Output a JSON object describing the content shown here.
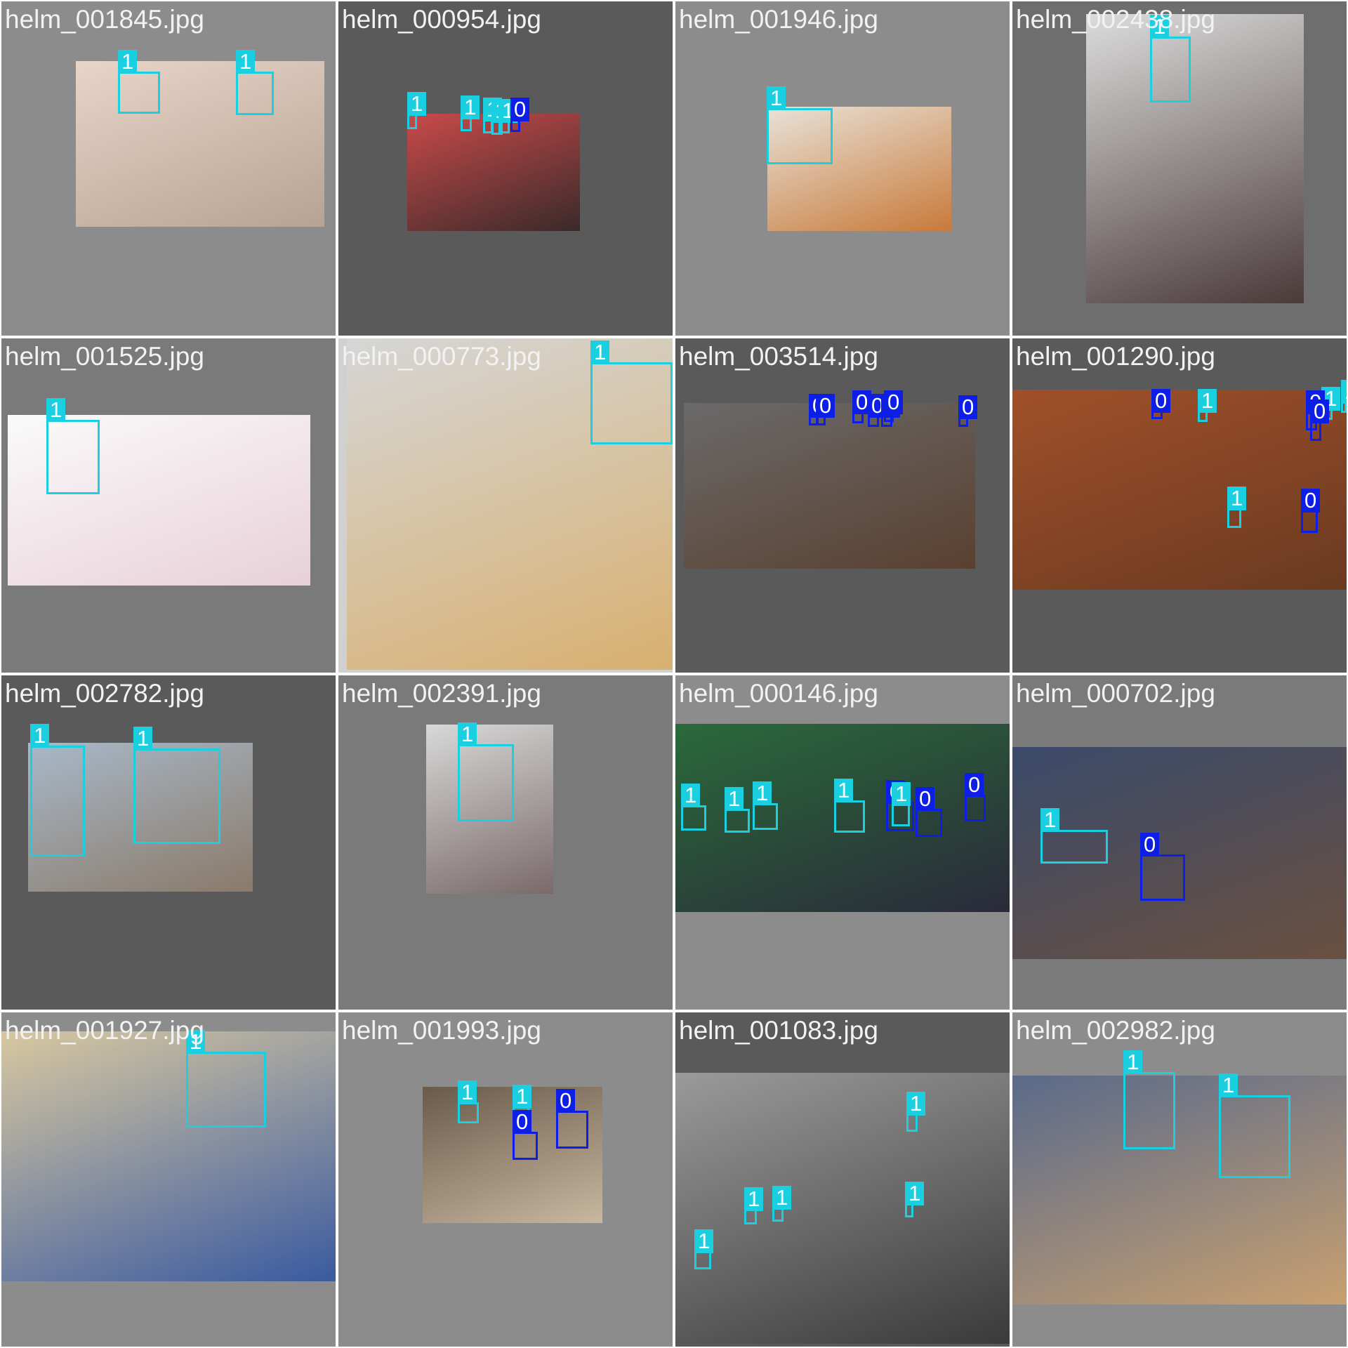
{
  "classes": {
    "0": {
      "color": "#0d1fe6"
    },
    "1": {
      "color": "#19cfe0"
    }
  },
  "tiles": [
    {
      "file": "helm_001845.jpg",
      "bg": "#8c8c8c",
      "photo_colors": [
        "#e8d5c8",
        "#b7a393"
      ],
      "boxes": [
        {
          "cls": "1"
        },
        {
          "cls": "1"
        }
      ]
    },
    {
      "file": "helm_000954.jpg",
      "bg": "#5a5a5a",
      "photo_colors": [
        "#c94a4a",
        "#3a2a2a"
      ],
      "boxes": [
        {
          "cls": "1"
        },
        {
          "cls": "1"
        },
        {
          "cls": "1"
        },
        {
          "cls": "1"
        },
        {
          "cls": "1"
        },
        {
          "cls": "0"
        }
      ]
    },
    {
      "file": "helm_001946.jpg",
      "bg": "#8c8c8c",
      "photo_colors": [
        "#e8e2d8",
        "#c87a3a"
      ],
      "boxes": [
        {
          "cls": "1"
        }
      ]
    },
    {
      "file": "helm_002438.jpg",
      "bg": "#6e6e6e",
      "photo_colors": [
        "#dcdcdc",
        "#4a3a3a"
      ],
      "boxes": [
        {
          "cls": "1"
        }
      ]
    },
    {
      "file": "helm_001525.jpg",
      "bg": "#7a7a7a",
      "photo_colors": [
        "#fafafa",
        "#e8d0d8"
      ],
      "boxes": [
        {
          "cls": "1"
        }
      ]
    },
    {
      "file": "helm_000773.jpg",
      "bg": "#d0d0d0",
      "photo_colors": [
        "#d6d6d6",
        "#d8b070"
      ],
      "boxes": [
        {
          "cls": "1"
        }
      ]
    },
    {
      "file": "helm_003514.jpg",
      "bg": "#5a5a5a",
      "photo_colors": [
        "#6a6a6a",
        "#5a4030"
      ],
      "boxes": [
        {
          "cls": "0"
        },
        {
          "cls": "0"
        },
        {
          "cls": "0"
        },
        {
          "cls": "0"
        },
        {
          "cls": "0"
        },
        {
          "cls": "0"
        },
        {
          "cls": "0"
        }
      ]
    },
    {
      "file": "helm_001290.jpg",
      "bg": "#5a5a5a",
      "photo_colors": [
        "#a0502a",
        "#6a3a20"
      ],
      "boxes": [
        {
          "cls": "0"
        },
        {
          "cls": "1"
        },
        {
          "cls": "1"
        },
        {
          "cls": "1"
        },
        {
          "cls": "0"
        },
        {
          "cls": "0"
        },
        {
          "cls": "1"
        },
        {
          "cls": "0"
        }
      ]
    },
    {
      "file": "helm_002782.jpg",
      "bg": "#5a5a5a",
      "photo_colors": [
        "#a8b8c8",
        "#8a7a6a"
      ],
      "boxes": [
        {
          "cls": "1"
        },
        {
          "cls": "1"
        }
      ]
    },
    {
      "file": "helm_002391.jpg",
      "bg": "#7a7a7a",
      "photo_colors": [
        "#d8d8d8",
        "#7a6a6a"
      ],
      "boxes": [
        {
          "cls": "1"
        }
      ]
    },
    {
      "file": "helm_000146.jpg",
      "bg": "#8c8c8c",
      "photo_colors": [
        "#2a6a3a",
        "#2a2a3a"
      ],
      "boxes": [
        {
          "cls": "1"
        },
        {
          "cls": "1"
        },
        {
          "cls": "1"
        },
        {
          "cls": "1"
        },
        {
          "cls": "0"
        },
        {
          "cls": "1"
        },
        {
          "cls": "0"
        },
        {
          "cls": "0"
        }
      ]
    },
    {
      "file": "helm_000702.jpg",
      "bg": "#7a7a7a",
      "photo_colors": [
        "#3a4a6a",
        "#6a5040"
      ],
      "boxes": [
        {
          "cls": "1"
        },
        {
          "cls": "0"
        }
      ]
    },
    {
      "file": "helm_001927.jpg",
      "bg": "#8c8c8c",
      "photo_colors": [
        "#d8c8a0",
        "#3a5aa0"
      ],
      "boxes": [
        {
          "cls": "1"
        }
      ]
    },
    {
      "file": "helm_001993.jpg",
      "bg": "#8c8c8c",
      "photo_colors": [
        "#6a5a4a",
        "#c8b8a0"
      ],
      "boxes": [
        {
          "cls": "1"
        },
        {
          "cls": "1"
        },
        {
          "cls": "0"
        },
        {
          "cls": "0"
        }
      ]
    },
    {
      "file": "helm_001083.jpg",
      "bg": "#5a5a5a",
      "photo_colors": [
        "#9a9a9a",
        "#3a3a3a"
      ],
      "boxes": [
        {
          "cls": "1"
        },
        {
          "cls": "1"
        },
        {
          "cls": "1"
        },
        {
          "cls": "1"
        },
        {
          "cls": "1"
        }
      ]
    },
    {
      "file": "helm_002982.jpg",
      "bg": "#8c8c8c",
      "photo_colors": [
        "#5a6a8a",
        "#c8a070"
      ],
      "boxes": [
        {
          "cls": "1"
        },
        {
          "cls": "1"
        }
      ]
    }
  ]
}
